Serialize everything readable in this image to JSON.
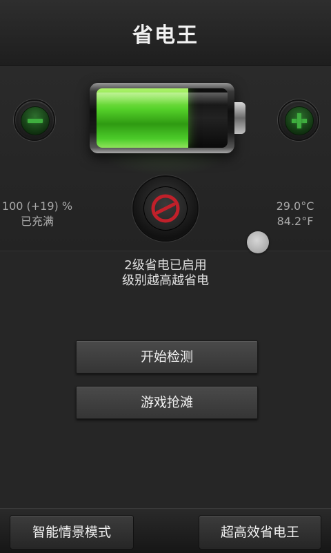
{
  "header": {
    "title": "省电王"
  },
  "battery": {
    "level_fraction": 0.7,
    "percent_text": "100 (+19) %",
    "charge_status": "已充满"
  },
  "temperature": {
    "celsius": "29.0°C",
    "fahrenheit": "84.2°F"
  },
  "controls": {
    "decrease_icon": "minus-icon",
    "increase_icon": "plus-icon",
    "mode_icon": "no-entry-icon"
  },
  "status": {
    "line1": "2级省电已启用",
    "line2": "级别越高越省电"
  },
  "actions": {
    "detect_label": "开始检测",
    "game_label": "游戏抢滩"
  },
  "bottom_tabs": {
    "left_label": "智能情景模式",
    "right_label": "超高效省电王"
  },
  "colors": {
    "battery_green": "#55d12a",
    "icon_green": "#3fae3f",
    "mode_red": "#c0202a",
    "background": "#262626"
  }
}
